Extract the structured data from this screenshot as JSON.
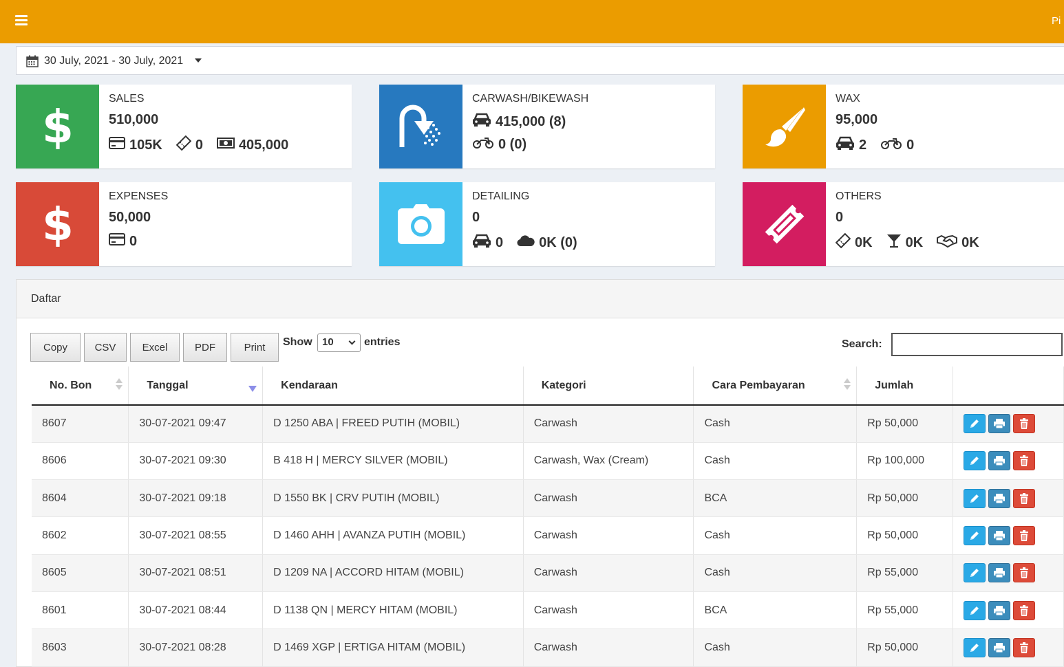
{
  "topbar": {
    "user_label": "Pi"
  },
  "daterange": {
    "label": "30 July, 2021 - 30 July, 2021"
  },
  "boxes": {
    "sales": {
      "title": "SALES",
      "value": "510,000",
      "card": "105K",
      "voucher": "0",
      "cash": "405,000",
      "color": "#37a753"
    },
    "carwash": {
      "title": "CARWASH/BIKEWASH",
      "car": "415,000 (8)",
      "bike": "0 (0)",
      "color": "#2779bf"
    },
    "wax": {
      "title": "WAX",
      "value": "95,000",
      "car": "2",
      "bike": "0",
      "color": "#eb9c00"
    },
    "expenses": {
      "title": "EXPENSES",
      "value": "50,000",
      "card": "0",
      "color": "#d84a38"
    },
    "detailing": {
      "title": "DETAILING",
      "value": "0",
      "car": "0",
      "cloud": "0K (0)",
      "color": "#44c1ef"
    },
    "others": {
      "title": "OTHERS",
      "value": "0",
      "voucher": "0K",
      "drink": "0K",
      "handshake": "0K",
      "color": "#d31d60"
    }
  },
  "panel": {
    "title": "Daftar",
    "buttons": {
      "copy": "Copy",
      "csv": "CSV",
      "excel": "Excel",
      "pdf": "PDF",
      "print": "Print"
    },
    "show_label": "Show",
    "page_size": "10",
    "entries_label": "entries",
    "search_label": "Search:",
    "search_value": ""
  },
  "table": {
    "headers": [
      "No. Bon",
      "Tanggal",
      "Kendaraan",
      "Kategori",
      "Cara Pembayaran",
      "Jumlah",
      ""
    ],
    "rows": [
      [
        "8607",
        "30-07-2021 09:47",
        "D 1250 ABA | FREED PUTIH (MOBIL)",
        "Carwash",
        "Cash",
        "Rp 50,000"
      ],
      [
        "8606",
        "30-07-2021 09:30",
        "B 418 H | MERCY SILVER (MOBIL)",
        "Carwash, Wax (Cream)",
        "Cash",
        "Rp 100,000"
      ],
      [
        "8604",
        "30-07-2021 09:18",
        "D 1550 BK | CRV PUTIH (MOBIL)",
        "Carwash",
        "BCA",
        "Rp 50,000"
      ],
      [
        "8602",
        "30-07-2021 08:55",
        "D 1460 AHH | AVANZA PUTIH (MOBIL)",
        "Carwash",
        "Cash",
        "Rp 50,000"
      ],
      [
        "8605",
        "30-07-2021 08:51",
        "D 1209 NA | ACCORD HITAM (MOBIL)",
        "Carwash",
        "Cash",
        "Rp 55,000"
      ],
      [
        "8601",
        "30-07-2021 08:44",
        "D 1138 QN | MERCY HITAM (MOBIL)",
        "Carwash",
        "BCA",
        "Rp 55,000"
      ],
      [
        "8603",
        "30-07-2021 08:28",
        "D 1469 XGP | ERTIGA HITAM (MOBIL)",
        "Carwash",
        "Cash",
        "Rp 50,000"
      ]
    ]
  }
}
